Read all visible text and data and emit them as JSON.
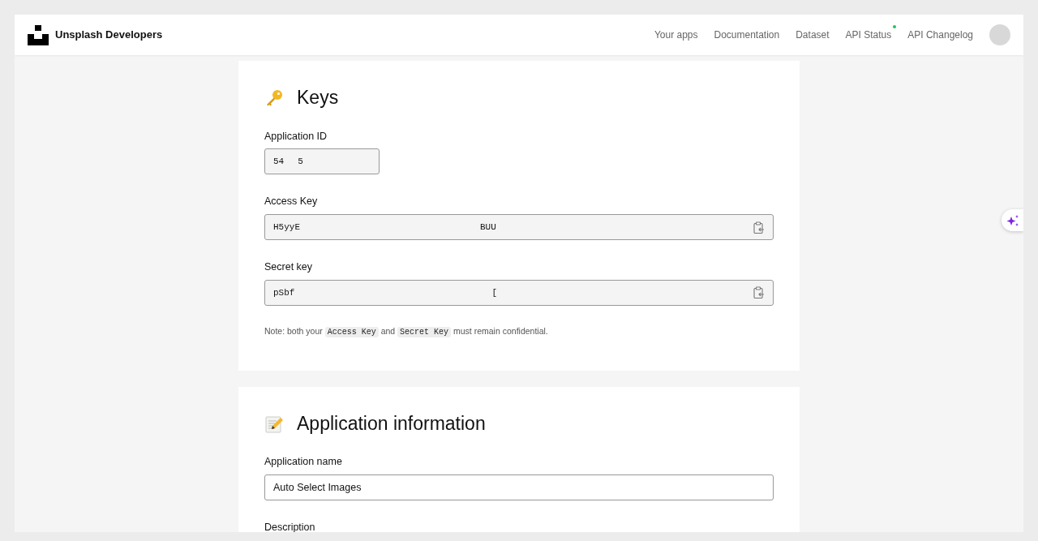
{
  "navbar": {
    "brand": "Unsplash Developers",
    "links": [
      {
        "label": "Your apps",
        "status_dot": false
      },
      {
        "label": "Documentation",
        "status_dot": false
      },
      {
        "label": "Dataset",
        "status_dot": false
      },
      {
        "label": "API Status",
        "status_dot": true
      },
      {
        "label": "API Changelog",
        "status_dot": false
      }
    ]
  },
  "sections": [
    {
      "kind": "keys",
      "title": "Keys",
      "fields": [
        {
          "label": "Application ID",
          "kind": "short",
          "parts": [
            "54",
            "5"
          ]
        },
        {
          "label": "Access Key",
          "kind": "copy",
          "parts": [
            "H5yyE",
            "BUU"
          ]
        },
        {
          "label": "Secret key",
          "kind": "copy",
          "parts": [
            "pSbf",
            "["
          ]
        }
      ],
      "note": [
        {
          "kind": "text",
          "text": "Note: both your "
        },
        {
          "kind": "code",
          "text": "Access Key"
        },
        {
          "kind": "text",
          "text": " and "
        },
        {
          "kind": "code",
          "text": "Secret Key"
        },
        {
          "kind": "text",
          "text": " must remain confidential."
        }
      ]
    },
    {
      "kind": "info",
      "title": "Application information",
      "fields": [
        {
          "label": "Application name",
          "kind": "editable",
          "value": "Auto Select Images"
        },
        {
          "label": "Description",
          "kind": "label_only"
        }
      ]
    }
  ]
}
